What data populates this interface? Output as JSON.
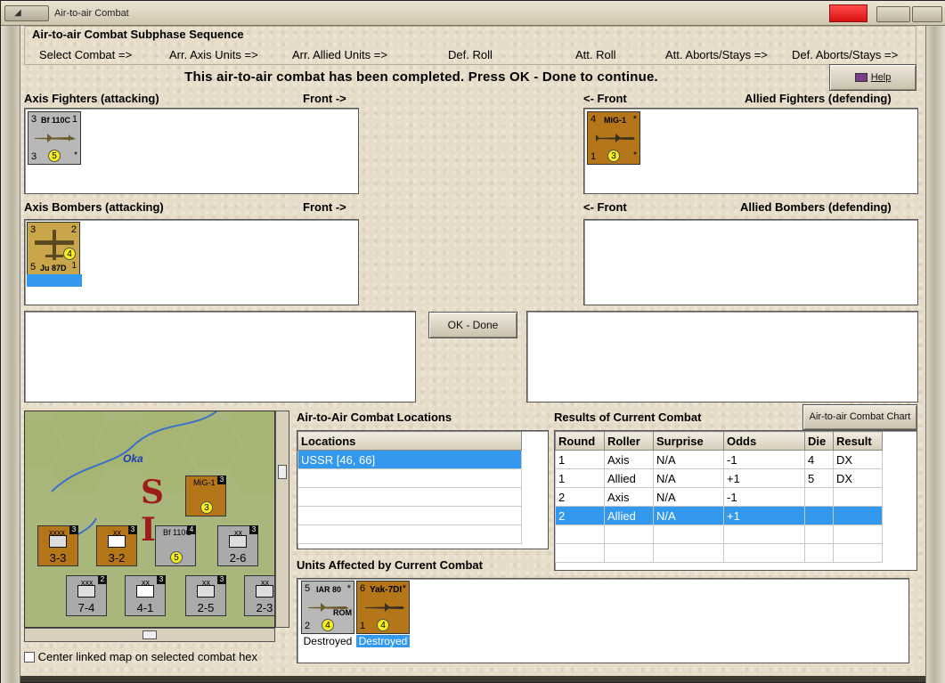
{
  "window": {
    "title": "Air-to-air Combat"
  },
  "phase": {
    "title": "Air-to-air Combat Subphase Sequence",
    "steps": [
      "Select Combat =>",
      "Arr. Axis Units =>",
      "Arr. Allied Units =>",
      "Def. Roll",
      "Att. Roll",
      "Att. Aborts/Stays =>",
      "Def. Aborts/Stays =>"
    ]
  },
  "message": "This air-to-air combat has been completed.  Press OK - Done to continue.",
  "help_button": "Help",
  "sections": {
    "axis_fighters": "Axis Fighters (attacking)",
    "axis_fighters_front": "Front ->",
    "allied_fighters_front": "<- Front",
    "allied_fighters": "Allied Fighters (defending)",
    "axis_bombers": "Axis Bombers (attacking)",
    "axis_bombers_front": "Front ->",
    "allied_bombers_front": "<- Front",
    "allied_bombers": "Allied Bombers (defending)"
  },
  "units": {
    "axis_fighter": {
      "name": "Bf 110C",
      "tl": "3",
      "tr": "1",
      "bl": "3",
      "circle": "5",
      "br": "*"
    },
    "allied_fighter": {
      "name": "MiG-1",
      "tl": "4",
      "tr": "*",
      "bl": "1",
      "circle": "3",
      "br": "*"
    },
    "axis_bomber": {
      "name": "Ju 87D",
      "tl": "3",
      "tr": "2",
      "bl": "5",
      "circle": "4",
      "br": "1"
    }
  },
  "ok_button": "OK - Done",
  "chart_button": "Air-to-air Combat Chart",
  "locations": {
    "title": "Air-to-Air Combat Locations",
    "header": "Locations",
    "rows": [
      "USSR [46, 66]"
    ]
  },
  "results": {
    "title": "Results of Current Combat",
    "headers": [
      "Round",
      "Roller",
      "Surprise",
      "Odds",
      "Die",
      "Result"
    ],
    "rows": [
      [
        "1",
        "Axis",
        "N/A",
        "-1",
        "4",
        "DX"
      ],
      [
        "1",
        "Allied",
        "N/A",
        "+1",
        "5",
        "DX"
      ],
      [
        "2",
        "Axis",
        "N/A",
        "-1",
        "",
        ""
      ],
      [
        "2",
        "Allied",
        "N/A",
        "+1",
        "",
        ""
      ]
    ],
    "selected_row": 3
  },
  "affected": {
    "title": "Units Affected by Current Combat",
    "units": [
      {
        "name": "IAR 80",
        "tl": "5",
        "tr": "*",
        "bl": "2",
        "circle": "4",
        "extra": "ROM",
        "status": "Destroyed"
      },
      {
        "name": "Yak-7DI",
        "tl": "6",
        "tr": "*",
        "bl": "1",
        "circle": "4",
        "extra": "",
        "status": "Destroyed"
      }
    ]
  },
  "map": {
    "river_label": "Oka",
    "city_label": "SC I",
    "counters": [
      {
        "label": "MiG-1",
        "value": "3"
      },
      {
        "label": "xxxx",
        "value": "3-3"
      },
      {
        "label": "xx",
        "value": "3-2"
      },
      {
        "label": "Bf 110C",
        "value": "5"
      },
      {
        "label": "xx",
        "value": "2-6"
      },
      {
        "label": "xxx",
        "value": "7-4"
      },
      {
        "label": "xx",
        "value": "4-1"
      },
      {
        "label": "xx",
        "value": "2-5"
      },
      {
        "label": "xx",
        "value": "2-3"
      }
    ]
  },
  "checkbox_label": "Center linked map on selected combat hex",
  "colors": {
    "selection": "#3399ee",
    "soviet": "#b5761a",
    "axis": "#b8b8b8",
    "close": "#e02020"
  }
}
